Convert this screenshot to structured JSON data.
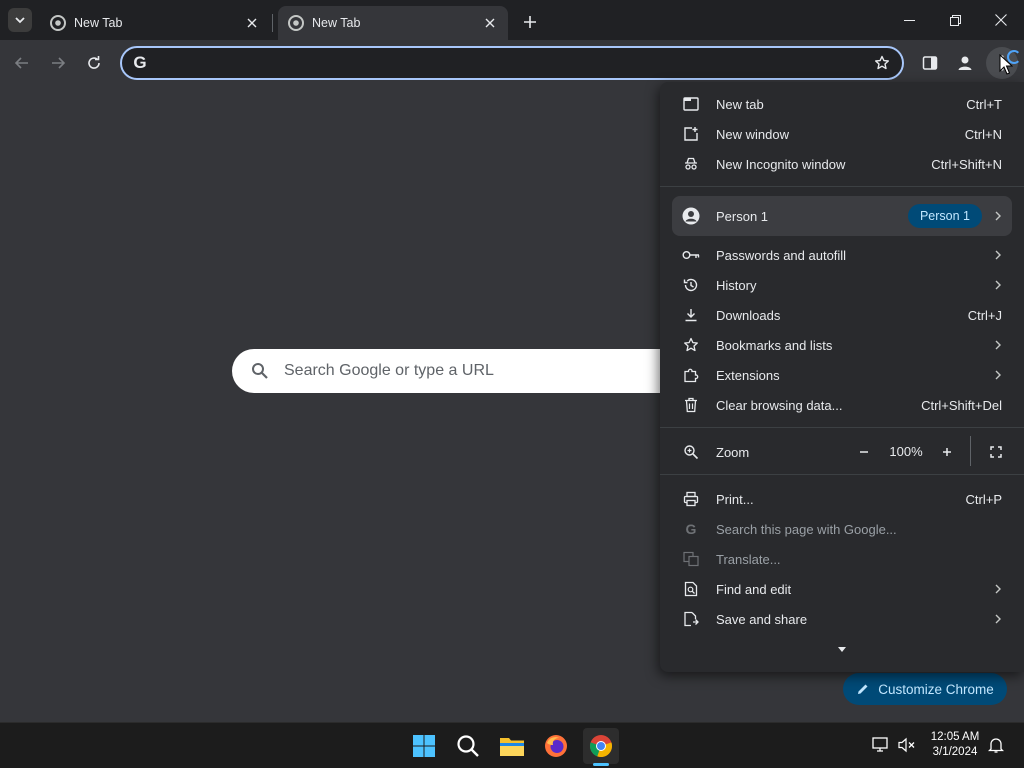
{
  "tabs": [
    {
      "title": "New Tab",
      "active": false
    },
    {
      "title": "New Tab",
      "active": true
    }
  ],
  "omnibox": {
    "value": "",
    "placeholder": ""
  },
  "ntp": {
    "search_placeholder": "Search Google or type a URL",
    "customize_label": "Customize Chrome"
  },
  "menu": {
    "new_tab": {
      "label": "New tab",
      "shortcut": "Ctrl+T"
    },
    "new_window": {
      "label": "New window",
      "shortcut": "Ctrl+N"
    },
    "new_incognito": {
      "label": "New Incognito window",
      "shortcut": "Ctrl+Shift+N"
    },
    "person": {
      "label": "Person 1",
      "badge": "Person 1"
    },
    "passwords": {
      "label": "Passwords and autofill"
    },
    "history": {
      "label": "History"
    },
    "downloads": {
      "label": "Downloads",
      "shortcut": "Ctrl+J"
    },
    "bookmarks": {
      "label": "Bookmarks and lists"
    },
    "extensions": {
      "label": "Extensions"
    },
    "clear_data": {
      "label": "Clear browsing data...",
      "shortcut": "Ctrl+Shift+Del"
    },
    "zoom": {
      "label": "Zoom",
      "value": "100%"
    },
    "print": {
      "label": "Print...",
      "shortcut": "Ctrl+P"
    },
    "search_page": {
      "label": "Search this page with Google..."
    },
    "translate": {
      "label": "Translate..."
    },
    "find_edit": {
      "label": "Find and edit"
    },
    "save_share": {
      "label": "Save and share"
    }
  },
  "taskbar": {
    "time": "12:05 AM",
    "date": "3/1/2024"
  },
  "colors": {
    "accent": "#a8c7fa",
    "badge_bg": "#004a77",
    "badge_fg": "#c2e7ff",
    "menu_bg": "#292a2d",
    "toolbar_bg": "#35363a"
  }
}
